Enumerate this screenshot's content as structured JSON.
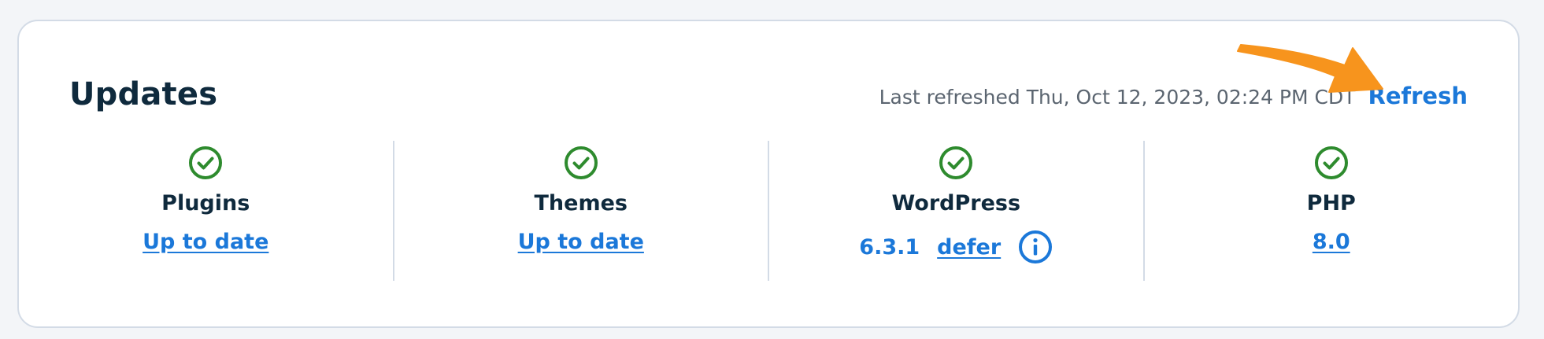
{
  "updates": {
    "title": "Updates",
    "last_refreshed": "Last refreshed Thu, Oct 12, 2023, 02:24 PM CDT",
    "refresh_label": "Refresh",
    "columns": [
      {
        "label": "Plugins",
        "status": "Up to date",
        "icon": "check-circle-icon"
      },
      {
        "label": "Themes",
        "status": "Up to date",
        "icon": "check-circle-icon"
      },
      {
        "label": "WordPress",
        "version": "6.3.1",
        "action": "defer",
        "icon": "check-circle-icon",
        "info_icon": "info-icon"
      },
      {
        "label": "PHP",
        "status": "8.0",
        "icon": "check-circle-icon"
      }
    ]
  },
  "colors": {
    "accent": "#1b78d9",
    "success": "#2e8b2e",
    "annotation_arrow": "#f7941d",
    "heading": "#0f2a3d"
  }
}
